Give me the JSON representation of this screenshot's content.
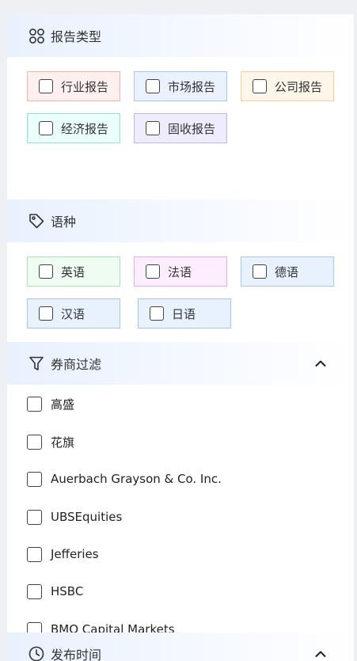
{
  "report_type": {
    "title": "报告类型",
    "icon": "grid-icon",
    "options": [
      {
        "label": "行业报告",
        "bg": "#fff0f0",
        "border": "#f3b3b3"
      },
      {
        "label": "市场报告",
        "bg": "#eaf2ff",
        "border": "#a9c6ee"
      },
      {
        "label": "公司报告",
        "bg": "#fff6ea",
        "border": "#f1cf9d"
      },
      {
        "label": "经济报告",
        "bg": "#eafffb",
        "border": "#8fe3d3"
      },
      {
        "label": "固收报告",
        "bg": "#f0ecff",
        "border": "#c2b4ea"
      }
    ]
  },
  "language": {
    "title": "语种",
    "icon": "tag-icon",
    "options": [
      {
        "label": "英语",
        "bg": "#eefcf2",
        "border": "#a7e1bb"
      },
      {
        "label": "法语",
        "bg": "#fdeefe",
        "border": "#e4aee9"
      },
      {
        "label": "德语",
        "bg": "#e8f1fe",
        "border": "#a9c6ee"
      },
      {
        "label": "汉语",
        "bg": "#e8f1fe",
        "border": "#a9c6ee"
      },
      {
        "label": "日语",
        "bg": "#e8f1fe",
        "border": "#a9c6ee"
      }
    ]
  },
  "broker_filter": {
    "title": "券商过滤",
    "icon": "filter-icon",
    "expanded": true,
    "items": [
      "高盛",
      "花旗",
      "Auerbach Grayson & Co. Inc.",
      "UBSEquities",
      "Jefferies",
      "HSBC",
      "BMO Capital Markets"
    ]
  },
  "publish_time": {
    "title": "发布时间",
    "icon": "clock-icon"
  }
}
